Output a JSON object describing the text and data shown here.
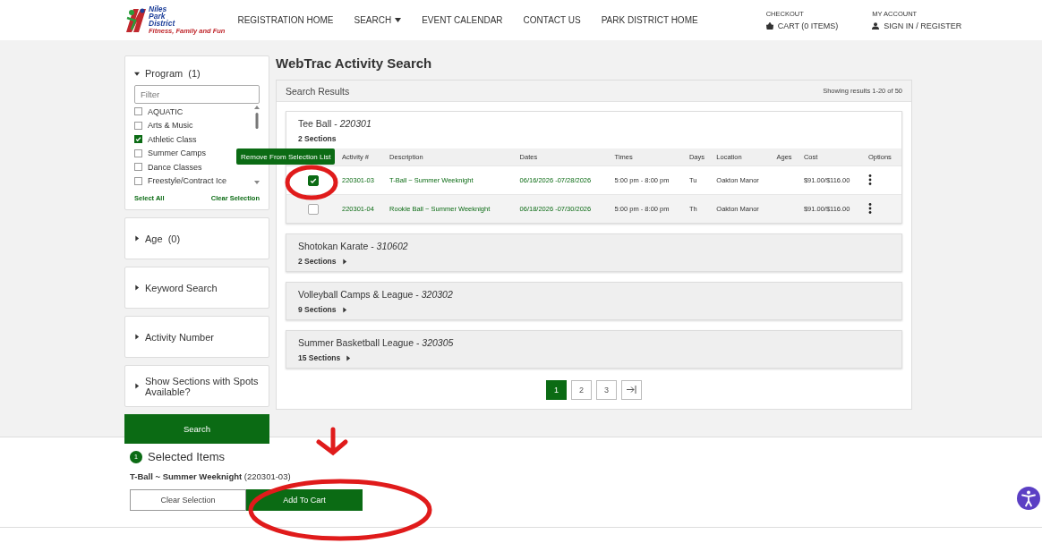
{
  "header": {
    "logo": {
      "title": "Niles Park District",
      "tagline": "Fitness, Family and Fun"
    },
    "nav": [
      {
        "label": "REGISTRATION HOME",
        "dropdown": false
      },
      {
        "label": "SEARCH",
        "dropdown": true
      },
      {
        "label": "EVENT CALENDAR",
        "dropdown": false
      },
      {
        "label": "CONTACT US",
        "dropdown": false
      },
      {
        "label": "PARK DISTRICT HOME",
        "dropdown": false
      }
    ],
    "checkout": {
      "label": "CHECKOUT",
      "link": "CART (0 ITEMS)"
    },
    "account": {
      "label": "MY ACCOUNT",
      "link": "SIGN IN / REGISTER"
    }
  },
  "sidebar": {
    "program": {
      "title": "Program",
      "count": "(1)",
      "expanded": true,
      "filter_placeholder": "Filter",
      "options": [
        {
          "label": "AQUATIC",
          "checked": false
        },
        {
          "label": "Arts & Music",
          "checked": false
        },
        {
          "label": "Athletic Class",
          "checked": true
        },
        {
          "label": "Summer Camps",
          "checked": false
        },
        {
          "label": "Dance Classes",
          "checked": false
        },
        {
          "label": "Freestyle/Contract Ice",
          "checked": false
        }
      ],
      "select_all": "Select All",
      "clear_selection": "Clear Selection"
    },
    "filters": [
      {
        "title": "Age",
        "count": "(0)",
        "expanded": false
      },
      {
        "title": "Keyword Search",
        "expanded": false
      },
      {
        "title": "Activity Number",
        "expanded": false
      },
      {
        "title": "Show Sections with Spots Available?",
        "expanded": false
      }
    ],
    "search_button": "Search"
  },
  "main": {
    "title": "WebTrac Activity Search",
    "results_title": "Search Results",
    "results_count": "Showing results 1-20 of 50",
    "activities": [
      {
        "name": "Tee Ball - *220301*",
        "sections": "2 Sections",
        "expanded": true,
        "columns": [
          "Activity #",
          "Description",
          "Dates",
          "Times",
          "Days",
          "Location",
          "Ages",
          "Cost",
          "Options"
        ],
        "rows": [
          {
            "selected": true,
            "activity_no": "220301-03",
            "description": "T-Ball ~ Summer Weeknight",
            "dates": "06/16/2026 -07/28/2026",
            "times": "5:00 pm - 8:00 pm",
            "days": "Tu",
            "location": "Oakton Manor",
            "cost": "$91.00/$116.00"
          },
          {
            "selected": false,
            "activity_no": "220301-04",
            "description": "Rookie Ball ~ Summer Weeknight",
            "dates": "06/18/2026 -07/30/2026",
            "times": "5:00 pm - 8:00 pm",
            "days": "Th",
            "location": "Oakton Manor",
            "cost": "$91.00/$116.00"
          }
        ]
      },
      {
        "name": "Shotokan Karate - *310602*",
        "sections": "2 Sections",
        "expanded": false
      },
      {
        "name": "Volleyball Camps & League - *320302*",
        "sections": "9 Sections",
        "expanded": false
      },
      {
        "name": "Summer Basketball League - *320305*",
        "sections": "15 Sections",
        "expanded": false
      }
    ],
    "tooltip": "Remove From Selection List",
    "pages": [
      {
        "label": "1",
        "selected": true
      },
      {
        "label": "2",
        "selected": false
      },
      {
        "label": "3",
        "selected": false
      }
    ]
  },
  "selection": {
    "count": "1",
    "title": "Selected Items",
    "item_name": "T-Ball ~ Summer Weeknight",
    "item_code": "(220301-03)",
    "buttons": [
      {
        "label": "Clear Selection",
        "kind": "secondary"
      },
      {
        "label": "Add To Cart",
        "kind": "primary"
      }
    ]
  }
}
